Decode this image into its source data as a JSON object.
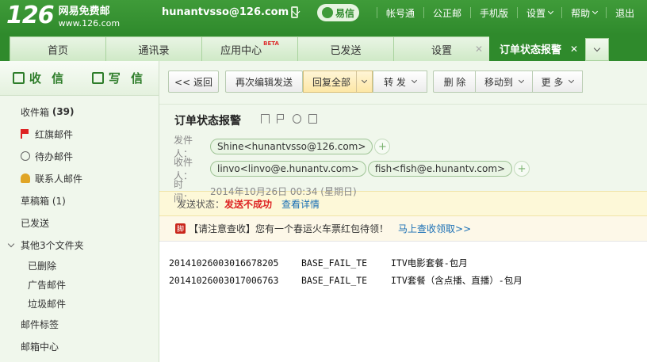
{
  "topbar": {
    "logo_num": "126",
    "logo_name": "网易免费邮",
    "logo_domain": "www.126.com",
    "account": "hunantvsso@126.com",
    "yixin": "易信",
    "links": [
      "帐号通",
      "公正邮",
      "手机版",
      "设置",
      "帮助",
      "退出"
    ]
  },
  "tabs": [
    {
      "label": "首页"
    },
    {
      "label": "通讯录"
    },
    {
      "label": "应用中心",
      "badge": "BETA"
    },
    {
      "label": "已发送"
    },
    {
      "label": "设置"
    },
    {
      "label": "订单状态报警"
    }
  ],
  "sidebar": {
    "compose": "收 信",
    "write": "写 信",
    "folders": [
      {
        "label": "收件箱",
        "count": "(39)"
      },
      {
        "label": "红旗邮件"
      },
      {
        "label": "待办邮件"
      },
      {
        "label": "联系人邮件"
      },
      {
        "label": "草稿箱 (1)"
      },
      {
        "label": "已发送"
      },
      {
        "label": "其他3个文件夹"
      },
      {
        "label": "已删除"
      },
      {
        "label": "广告邮件"
      },
      {
        "label": "垃圾邮件"
      },
      {
        "label": "邮件标签"
      },
      {
        "label": "邮箱中心"
      }
    ]
  },
  "toolbar": {
    "back": "<< 返回",
    "reedit": "再次编辑发送",
    "reply_all": "回复全部",
    "forward": "转 发",
    "delete": "删 除",
    "move": "移动到",
    "more": "更 多"
  },
  "mail": {
    "subject": "订单状态报警",
    "from_label": "发件人：",
    "from": "Shine<hunantvsso@126.com>",
    "to_label": "收件人：",
    "to": [
      "linvo<linvo@e.hunantv.com>",
      "fish<fish@e.hunantv.com>"
    ],
    "time_label": "时　间：",
    "time": "2014年10月26日 00:34 (星期日)"
  },
  "status": {
    "label": "发送状态：",
    "value": "发送不成功",
    "detail": "查看详情"
  },
  "promo": {
    "icon": "脚",
    "text": "【请注意查收】您有一个春运火车票红包待领！",
    "link": "马上查收领取>>"
  },
  "body": [
    [
      "20141026003016678205",
      "BASE_FAIL_TE",
      "ITV电影套餐-包月"
    ],
    [
      "20141026003017006763",
      "BASE_FAIL_TE",
      "ITV套餐（含点播、直播）-包月"
    ]
  ]
}
